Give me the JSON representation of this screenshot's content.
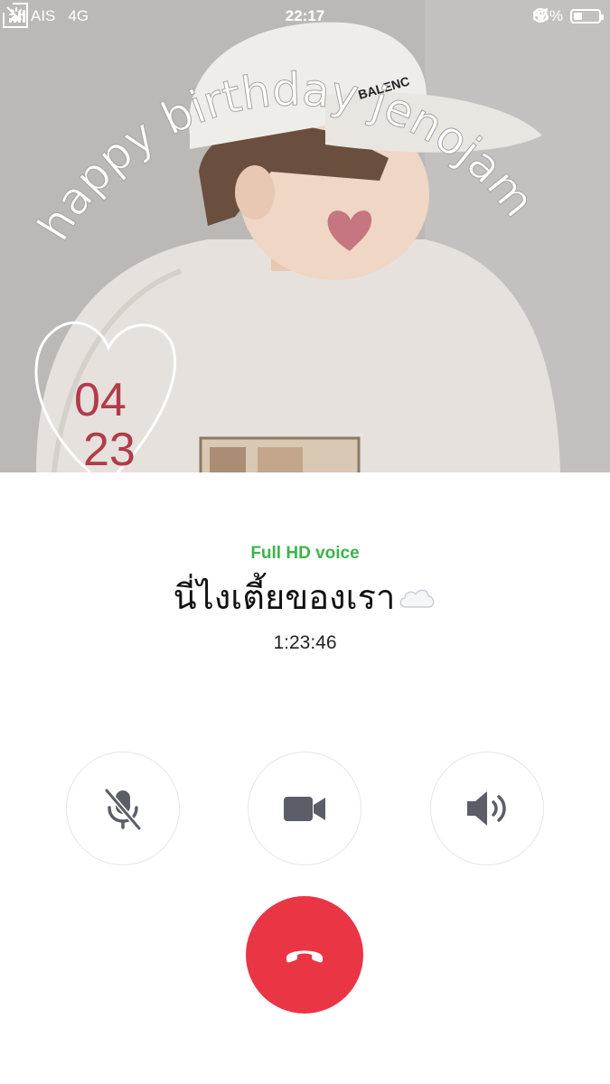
{
  "status_bar": {
    "carrier": "AIS",
    "network": "4G",
    "time": "22:17",
    "battery_percent_label": "35%",
    "battery_level": 0.35
  },
  "photo": {
    "arc_text": "happy birthday jenojam",
    "cap_text": "BALENC",
    "date_top": "04",
    "date_bottom": "23"
  },
  "call": {
    "quality_label": "Full HD voice",
    "contact_name": "นี่ไงเตี้ยของเรา",
    "duration": "1:23:46"
  },
  "controls": {
    "mute_icon": "mic-off-icon",
    "video_icon": "video-camera-icon",
    "speaker_icon": "speaker-icon",
    "end_icon": "hang-up-icon"
  },
  "colors": {
    "quality_green": "#3ab54a",
    "end_call_red": "#ea3545",
    "icon_gray": "#5b5e66"
  }
}
